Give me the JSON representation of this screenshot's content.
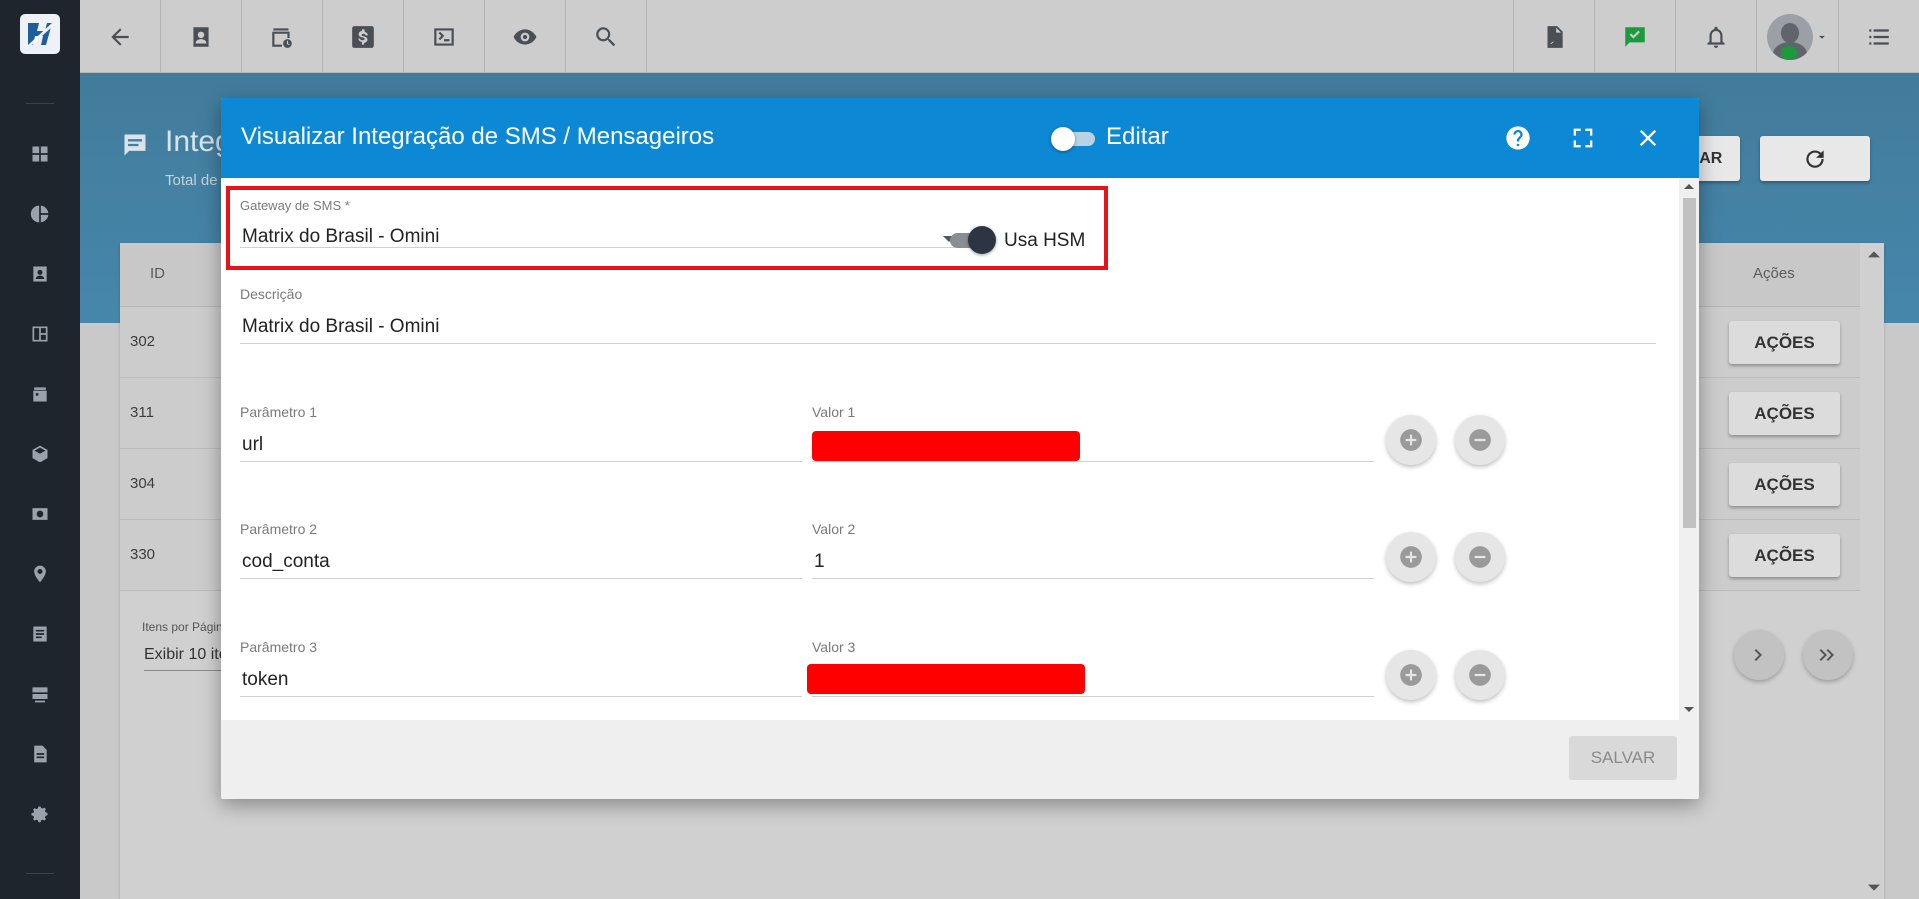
{
  "topbar": {
    "icons": [
      "back-arrow-icon",
      "contact-card-icon",
      "calendar-clock-icon",
      "dollar-icon",
      "terminal-icon",
      "eye-icon",
      "search-icon",
      "pdf-icon",
      "chat-check-icon",
      "bell-icon",
      "user-avatar",
      "list-menu-icon"
    ]
  },
  "background_page": {
    "title": "Integ",
    "subtitle": "Total de",
    "partial_button": "NAR",
    "table": {
      "headers": {
        "id": "ID",
        "actions": "Ações"
      },
      "rows": [
        {
          "id": "302",
          "action": "AÇÕES"
        },
        {
          "id": "311",
          "action": "AÇÕES"
        },
        {
          "id": "304",
          "action": "AÇÕES"
        },
        {
          "id": "330",
          "action": "AÇÕES"
        }
      ]
    },
    "pagination": {
      "items_label": "Itens por Págin",
      "items_value": "Exibir 10 ite"
    }
  },
  "modal": {
    "title": "Visualizar Integração de SMS / Mensageiros",
    "edit_label": "Editar",
    "gateway": {
      "label": "Gateway de SMS",
      "required_mark": "*",
      "value": "Matrix do Brasil - Omini"
    },
    "usa_hsm_label": "Usa HSM",
    "descricao": {
      "label": "Descrição",
      "value": "Matrix do Brasil - Omini"
    },
    "params": [
      {
        "param_label": "Parâmetro 1",
        "param_value": "url",
        "value_label": "Valor 1",
        "value": ""
      },
      {
        "param_label": "Parâmetro 2",
        "param_value": "cod_conta",
        "value_label": "Valor 2",
        "value": "1"
      },
      {
        "param_label": "Parâmetro 3",
        "param_value": "token",
        "value_label": "Valor 3",
        "value": ""
      }
    ],
    "save_label": "SALVAR"
  },
  "colors": {
    "modal_header": "#0c88d5",
    "highlight": "#e8131a",
    "redaction": "#ff0000",
    "sidebar": "#1f252c"
  }
}
